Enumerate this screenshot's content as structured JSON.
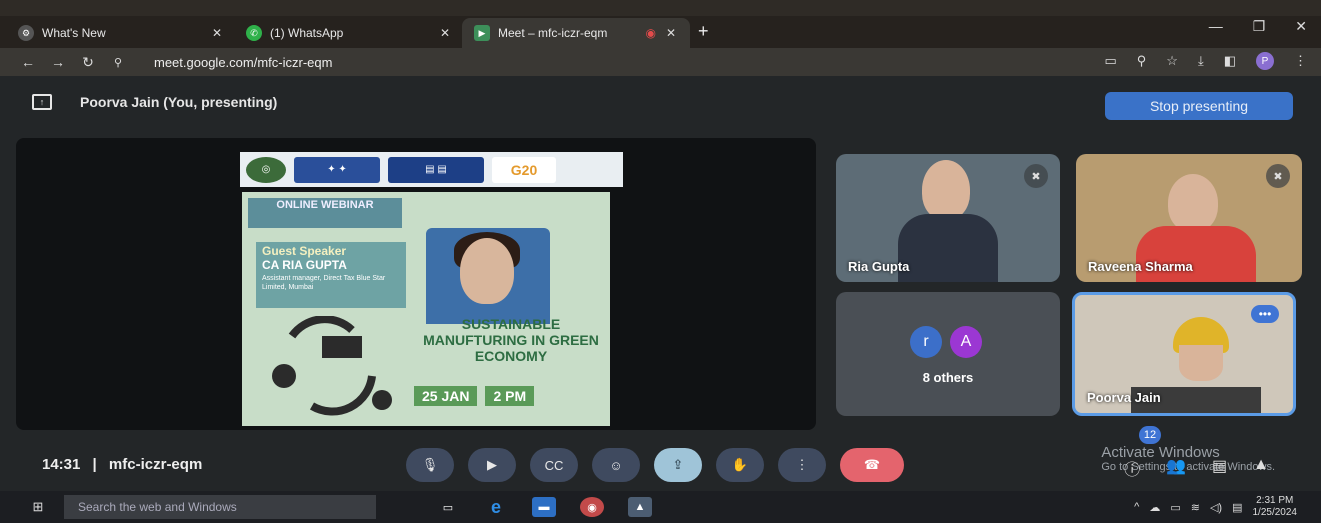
{
  "browser": {
    "tabs": [
      {
        "label": "What's New",
        "icon": "gear-icon",
        "active": false
      },
      {
        "label": "(1) WhatsApp",
        "icon": "whatsapp-icon",
        "active": false
      },
      {
        "label": "Meet – mfc-iczr-eqm",
        "icon": "meet-icon",
        "active": true
      }
    ],
    "url": "meet.google.com/mfc-iczr-eqm",
    "profile_initial": "P"
  },
  "meet": {
    "presenting_text": "Poorva Jain (You, presenting)",
    "stop_label": "Stop presenting",
    "presentation": {
      "header_logos": [
        "logo-1",
        "india-emblem",
        "program-banner",
        "g20-logo"
      ],
      "g20_text": "G20",
      "online_webinar": "ONLINE WEBINAR",
      "guest_speaker": "Guest Speaker",
      "speaker_name": "CA RIA GUPTA",
      "speaker_role": "Assistant manager, Direct Tax Blue Star Limited, Mumbai",
      "topic": "SUSTAINABLE MANUFTURING IN GREEN ECONOMY",
      "date": "25 JAN",
      "time": "2 PM"
    },
    "participants": [
      {
        "name": "Ria Gupta",
        "muted": true
      },
      {
        "name": "Raveena Sharma",
        "muted": true
      },
      {
        "name": "Poorva Jain",
        "muted": false
      }
    ],
    "others": {
      "label": "8 others",
      "avatars": [
        "r",
        "A"
      ]
    },
    "meeting_time": "14:31",
    "meeting_code": "mfc-iczr-eqm",
    "participant_count": "12",
    "activate_title": "Activate Windows",
    "activate_sub": "Go to Settings to activate Windows."
  },
  "taskbar": {
    "search_placeholder": "Search the web and Windows",
    "time": "2:31 PM",
    "date": "1/25/2024"
  },
  "colors": {
    "stop_button": "#3a72c8",
    "end_call": "#e4646d",
    "control_bg": "#3f4a5f",
    "active_tile_border": "#5b9be6"
  }
}
